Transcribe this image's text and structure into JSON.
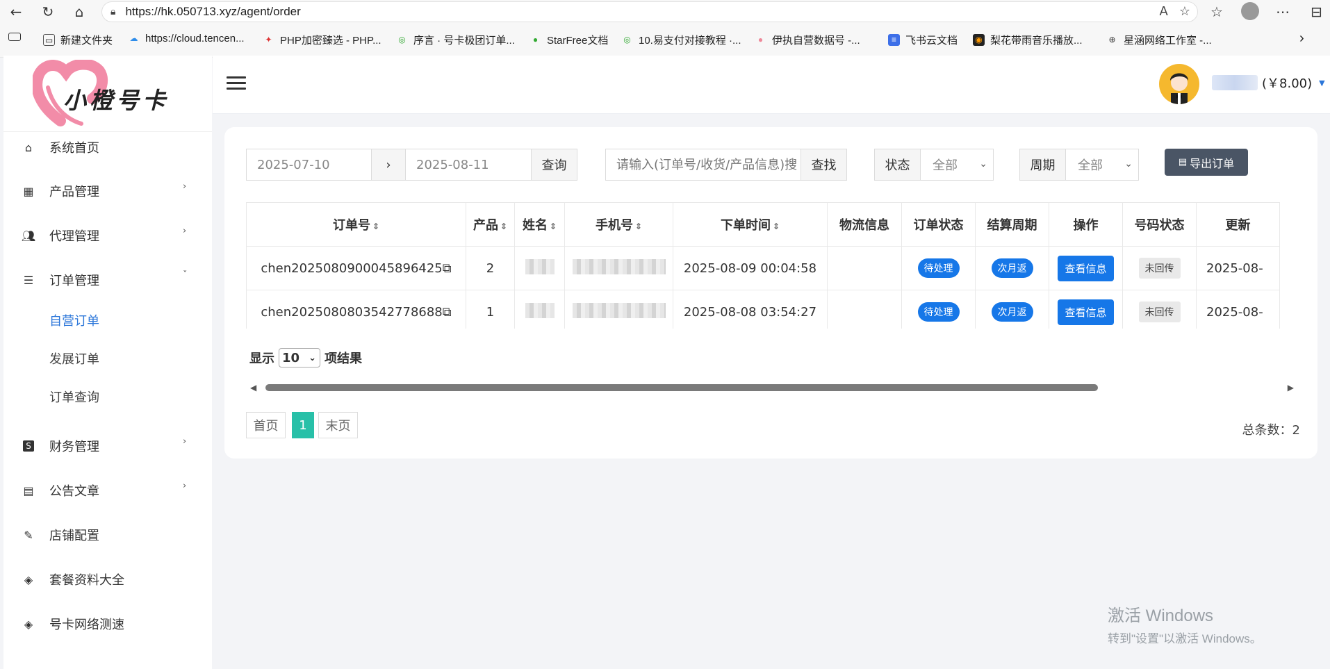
{
  "browser": {
    "url": "https://hk.050713.xyz/agent/order",
    "bookmarks": [
      "新建文件夹",
      "https://cloud.tencen...",
      "PHP加密臻选 - PHP...",
      "序言 · 号卡极团订单...",
      "StarFree文档",
      "10.易支付对接教程 ·...",
      "伊执自营数据号 -...",
      "飞书云文档",
      "梨花带雨音乐播放...",
      "星涵网络工作室 -..."
    ]
  },
  "logo": {
    "text": "小橙号卡"
  },
  "sidebar": {
    "items": [
      {
        "label": "系统首页",
        "icon": "home-icon"
      },
      {
        "label": "产品管理",
        "icon": "grid-icon"
      },
      {
        "label": "代理管理",
        "icon": "users-icon"
      },
      {
        "label": "订单管理",
        "icon": "list-icon"
      },
      {
        "label": "财务管理",
        "icon": "dollar-icon"
      },
      {
        "label": "公告文章",
        "icon": "article-icon"
      },
      {
        "label": "店铺配置",
        "icon": "store-config-icon"
      },
      {
        "label": "套餐资料大全",
        "icon": "compass-icon"
      },
      {
        "label": "号卡网络测速",
        "icon": "compass-icon"
      }
    ],
    "sub": [
      "自营订单",
      "发展订单",
      "订单查询"
    ]
  },
  "header": {
    "balance": "(￥8.00)"
  },
  "filters": {
    "date_start": "2025-07-10",
    "date_arrow": "›",
    "date_end": "2025-08-11",
    "query_btn": "查询",
    "search_placeholder": "请输入(订单号/收货/产品信息)搜",
    "search_btn": "查找",
    "status_label": "状态",
    "status_value": "全部",
    "period_label": "周期",
    "period_value": "全部",
    "export_btn": "导出订单"
  },
  "table": {
    "headers": [
      "订单号",
      "产品",
      "姓名",
      "手机号",
      "下单时间",
      "物流信息",
      "订单状态",
      "结算周期",
      "操作",
      "号码状态",
      "更新"
    ],
    "rows": [
      {
        "order": "chen2025080900045896425",
        "product": "2",
        "time": "2025-08-09 00:04:58",
        "status": "待处理",
        "period": "次月返",
        "action": "查看信息",
        "num_status": "未回传",
        "updated": "2025-08-"
      },
      {
        "order": "chen2025080803542778688",
        "product": "1",
        "time": "2025-08-08 03:54:27",
        "status": "待处理",
        "period": "次月返",
        "action": "查看信息",
        "num_status": "未回传",
        "updated": "2025-08-"
      }
    ]
  },
  "footer": {
    "show_prefix": "显示",
    "page_size": "10",
    "show_suffix": "项结果",
    "first": "首页",
    "current": "1",
    "last": "末页",
    "total": "总条数：2"
  },
  "watermark": {
    "line1": "激活 Windows",
    "line2": "转到\"设置\"以激活 Windows。"
  }
}
